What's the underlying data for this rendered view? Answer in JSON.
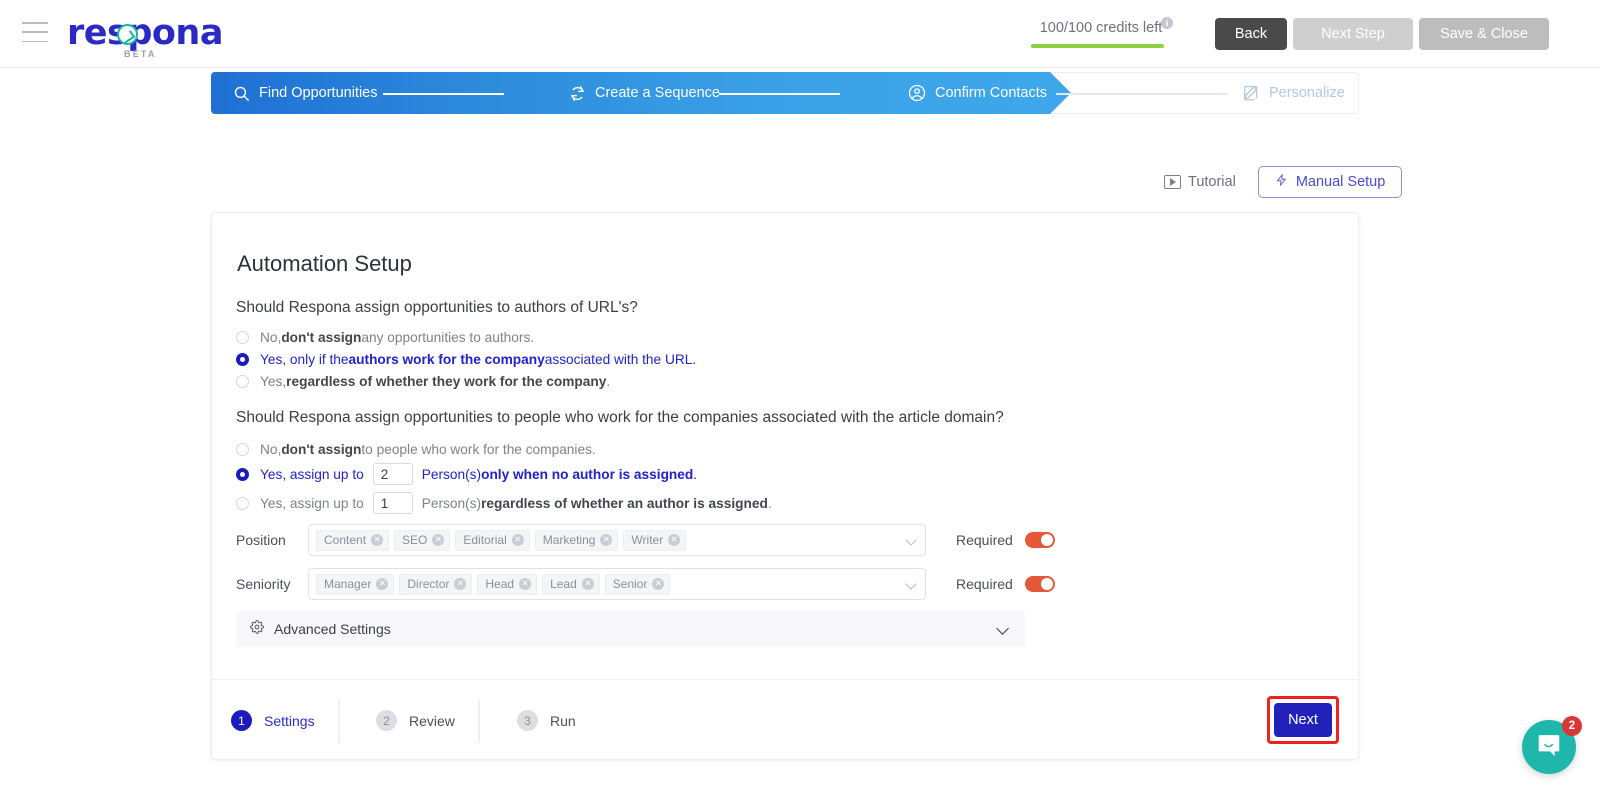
{
  "topbar": {
    "menu_icon": "hamburger-icon",
    "brand": "respona",
    "brand_tag": "BETA",
    "credits_text": "100/100 credits left",
    "credits_info_icon": "info-icon",
    "back_label": "Back",
    "next_step_label": "Next Step",
    "save_close_label": "Save & Close",
    "accent_brand": "#2b2bc4",
    "accent_teal": "#16b5a4",
    "credits_bar_color": "#8cd23f"
  },
  "stepper": {
    "steps": [
      {
        "label": "Find Opportunities",
        "icon": "search-icon",
        "state": "done"
      },
      {
        "label": "Create a Sequence",
        "icon": "refresh-icon",
        "state": "done"
      },
      {
        "label": "Confirm Contacts",
        "icon": "user-circle-icon",
        "state": "active"
      },
      {
        "label": "Personalize",
        "icon": "pencil-square-icon",
        "state": "upcoming"
      }
    ]
  },
  "toolbar": {
    "tutorial_label": "Tutorial",
    "tutorial_icon": "play-icon",
    "manual_setup_label": "Manual Setup",
    "manual_setup_icon": "lightning-icon"
  },
  "card": {
    "title": "Automation Setup",
    "question1": {
      "text": "Should Respona assign opportunities to authors of URL's?",
      "options": [
        {
          "pre": "No, ",
          "bold": "don't assign",
          "post": " any opportunities to authors.",
          "selected": false
        },
        {
          "pre": "Yes, only if the ",
          "bold": "authors work for the company",
          "post": " associated with the URL.",
          "selected": true
        },
        {
          "pre": "Yes, ",
          "bold": "regardless of whether they work for the company",
          "post": ".",
          "selected": false
        }
      ]
    },
    "question2": {
      "text": "Should Respona assign opportunities to people who work for the companies associated with the article domain?",
      "options": [
        {
          "pre": "No, ",
          "bold": "don't assign",
          "post": " to people who work for the companies.",
          "selected": false,
          "has_input": false
        },
        {
          "pre": "Yes, assign up to ",
          "value": "2",
          "mid": "Person(s) ",
          "bold": "only when no author is assigned",
          "post": ".",
          "selected": true,
          "has_input": true
        },
        {
          "pre": "Yes, assign up to ",
          "value": "1",
          "mid": "Person(s) ",
          "bold": "regardless of whether an author is assigned",
          "post": ".",
          "selected": false,
          "has_input": true
        }
      ]
    },
    "position_field": {
      "label": "Position",
      "tags": [
        "Content",
        "SEO",
        "Editorial",
        "Marketing",
        "Writer"
      ],
      "required_label": "Required",
      "required_on": true
    },
    "seniority_field": {
      "label": "Seniority",
      "tags": [
        "Manager",
        "Director",
        "Head",
        "Lead",
        "Senior"
      ],
      "required_label": "Required",
      "required_on": true
    },
    "advanced": {
      "label": "Advanced Settings",
      "icon": "gear-icon",
      "chevron": "chevron-down-icon"
    },
    "footer": {
      "steps": [
        {
          "num": "1",
          "label": "Settings",
          "active": true
        },
        {
          "num": "2",
          "label": "Review",
          "active": false
        },
        {
          "num": "3",
          "label": "Run",
          "active": false
        }
      ],
      "next_label": "Next",
      "next_highlight_color": "#ef2121"
    }
  },
  "chat": {
    "icon": "chat-smile-icon",
    "badge": "2",
    "color": "#1fb6ac"
  }
}
